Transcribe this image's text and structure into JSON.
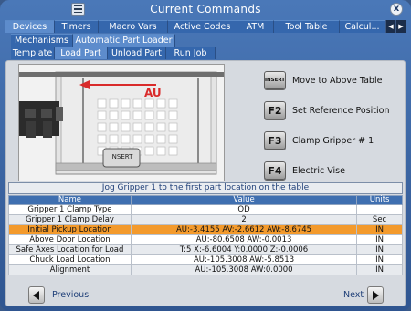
{
  "window": {
    "title": "Current Commands",
    "close_label": "x"
  },
  "tabs_main": [
    {
      "label": "Devices",
      "active": true
    },
    {
      "label": "Timers",
      "active": false
    },
    {
      "label": "Macro Vars",
      "active": false
    },
    {
      "label": "Active Codes",
      "active": false
    },
    {
      "label": "ATM",
      "active": false
    },
    {
      "label": "Tool Table",
      "active": false
    },
    {
      "label": "Calcul...",
      "active": false
    }
  ],
  "tabs_sub": [
    {
      "label": "Mechanisms",
      "active": false
    },
    {
      "label": "Automatic Part Loader",
      "active": true
    }
  ],
  "tabs_apl": [
    {
      "label": "Template",
      "active": false
    },
    {
      "label": "Load Part",
      "active": true
    },
    {
      "label": "Unload Part",
      "active": false
    },
    {
      "label": "Run Job",
      "active": false
    }
  ],
  "illustration": {
    "axis_label": "AU",
    "insert_label": "INSERT"
  },
  "actions": [
    {
      "key": "INSERT",
      "label": "Move to Above Table"
    },
    {
      "key": "F2",
      "label": "Set Reference Position"
    },
    {
      "key": "F3",
      "label": "Clamp Gripper # 1"
    },
    {
      "key": "F4",
      "label": "Electric Vise"
    }
  ],
  "instruction": "Jog Gripper 1 to the first part location on the table",
  "table": {
    "headers": [
      "Name",
      "Value",
      "Units"
    ],
    "rows": [
      {
        "name": "Gripper 1 Clamp Type",
        "value": "OD",
        "units": ""
      },
      {
        "name": "Gripper 1 Clamp Delay",
        "value": "2",
        "units": "Sec"
      },
      {
        "name": "Initial Pickup Location",
        "value": "AU:-3.4155 AV:-2.6612 AW:-8.6745",
        "units": "IN",
        "highlight": true
      },
      {
        "name": "Above Door Location",
        "value": "AU:-80.6508 AW:-0.0013",
        "units": "IN"
      },
      {
        "name": "Safe Axes Location for Load",
        "value": "T:5 X:-6.6004 Y:0.0000 Z:-0.0006",
        "units": "IN"
      },
      {
        "name": "Chuck Load Location",
        "value": "AU:-105.3008 AW:-5.8513",
        "units": "IN"
      },
      {
        "name": "Alignment",
        "value": "AU:-105.3008 AW:0.0000",
        "units": "IN"
      }
    ]
  },
  "nav": {
    "previous_label": "Previous",
    "next_label": "Next"
  },
  "colors": {
    "accent_blue": "#3f6fb0",
    "highlight_orange": "#f39a2c",
    "axis_red": "#d92b2b"
  }
}
